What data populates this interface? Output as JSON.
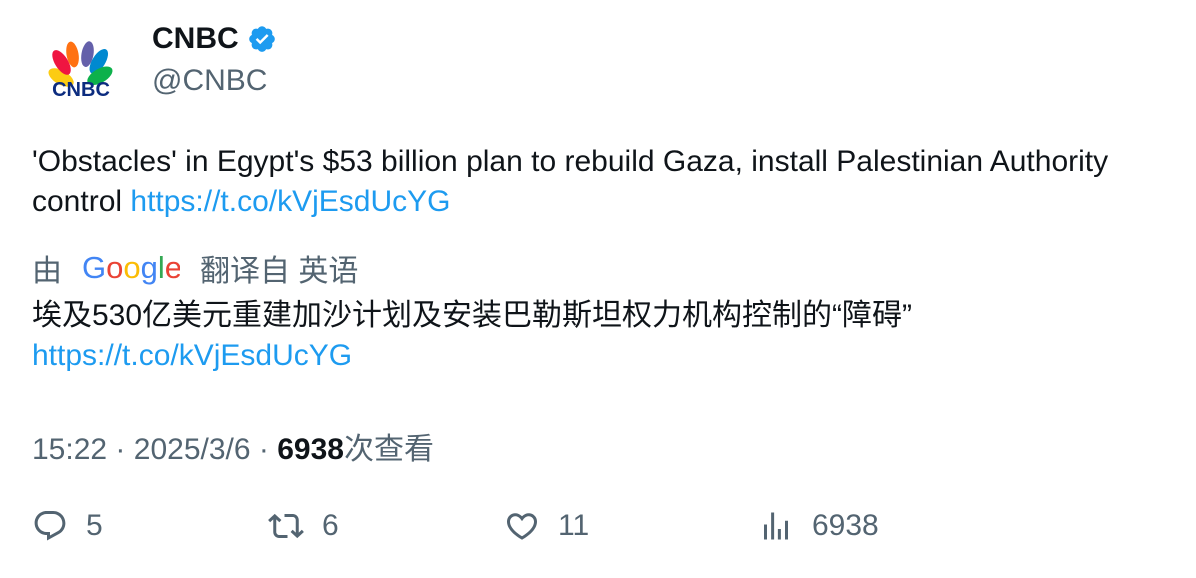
{
  "author": {
    "display_name": "CNBC",
    "handle": "@CNBC",
    "avatar_logo_text": "CNBC"
  },
  "tweet": {
    "text": "'Obstacles' in Egypt's $53 billion plan to rebuild Gaza, install Palestinian Authority control",
    "link": "https://t.co/kVjEsdUcYG"
  },
  "translation": {
    "prefix": "由",
    "provider": "Google",
    "suffix": "翻译自 英语",
    "text": "埃及530亿美元重建加沙计划及安装巴勒斯坦权力机构控制的“障碍”",
    "link": "https://t.co/kVjEsdUcYG"
  },
  "meta": {
    "time": "15:22",
    "separator1": "·",
    "date": "2025/3/6",
    "separator2": "·",
    "views_count": "6938",
    "views_label": "次查看"
  },
  "actions": {
    "replies": "5",
    "retweets": "6",
    "likes": "11",
    "views": "6938"
  },
  "colors": {
    "link": "#1d9bf0",
    "secondary_text": "#536471",
    "primary_text": "#0f1419",
    "verified_badge": "#1d9bf0"
  }
}
